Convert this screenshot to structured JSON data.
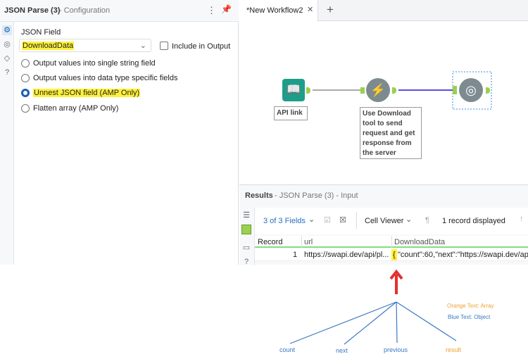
{
  "config": {
    "title": "JSON Parse (3)",
    "subtitle": "- Configuration",
    "field_label": "JSON Field",
    "field_value": "DownloadData",
    "include_label": "Include in Output",
    "options": [
      "Output values into single string field",
      "Output values into data type specific fields",
      "Unnest JSON field (AMP Only)",
      "Flatten array (AMP Only)"
    ],
    "selected_index": 2
  },
  "canvas": {
    "tab": "*New Workflow2",
    "tool1_note": "API link",
    "tool2_note": "Use Download tool to send request and get response from the server"
  },
  "results": {
    "title": "Results",
    "subtitle": "- JSON Parse (3) - Input",
    "fields": "3 of 3 Fields",
    "viewer": "Cell Viewer",
    "records": "1 record displayed",
    "columns": [
      "Record",
      "url",
      "DownloadData"
    ],
    "row": {
      "record": "1",
      "url": "https://swapi.dev/api/pl...",
      "data_brace": "{",
      "data": "\"count\":60,\"next\":\"https://swapi.dev/api/p"
    }
  },
  "annotation": {
    "labels": [
      "count",
      "next",
      "previous",
      "result"
    ],
    "legend_array": "Orange Text: Array",
    "legend_object": "Blue Text: Object",
    "colors": {
      "blue": "#3a78c4",
      "orange": "#f0a030",
      "red": "#e53030"
    }
  }
}
